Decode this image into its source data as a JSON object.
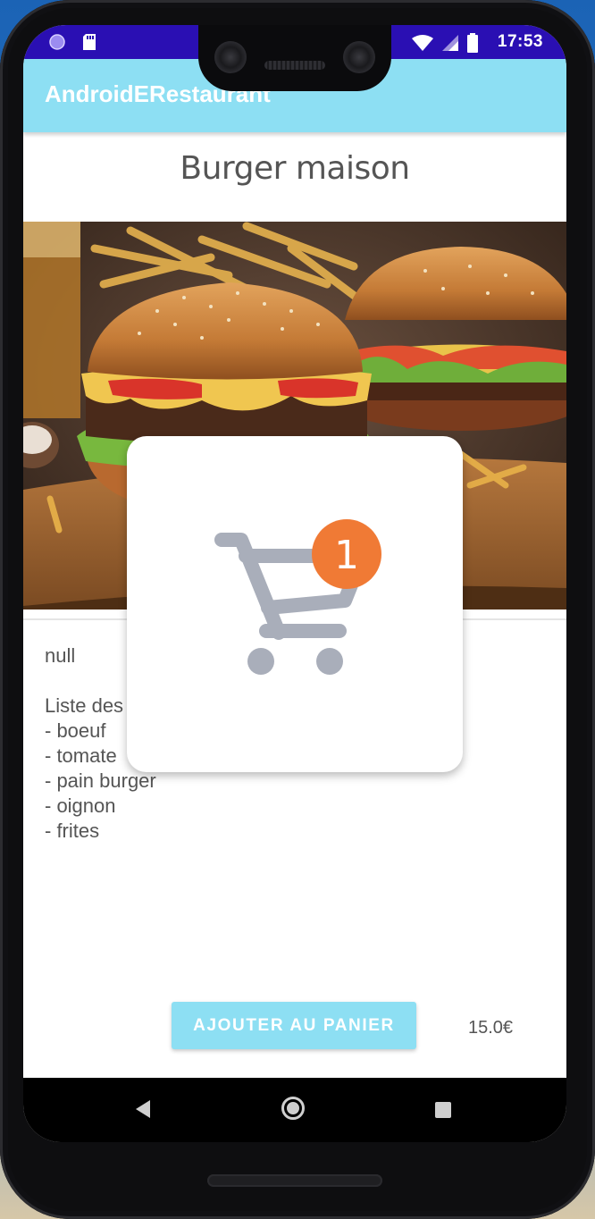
{
  "status_bar": {
    "time": "17:53",
    "left_icons": [
      "circle-notification-icon",
      "sd-card-icon"
    ],
    "right_icons": [
      "wifi-icon",
      "signal-icon",
      "battery-icon"
    ]
  },
  "app_bar": {
    "title": "AndroidERestaurant"
  },
  "dish": {
    "title": "Burger maison",
    "image_icon": "burger-photo",
    "description": "null\n\nListe des ingrédients:\n- boeuf\n- tomate\n- pain burger\n- oignon\n- frites",
    "add_to_cart_label": "AJOUTER AU PANIER",
    "price": "15.0€"
  },
  "cart_dialog": {
    "icon": "shopping-cart-icon",
    "badge_count": "1",
    "badge_color": "#f07a35",
    "cart_color": "#a9aeba"
  },
  "nav_bar": {
    "buttons": [
      "back-icon",
      "home-icon",
      "recents-icon"
    ]
  },
  "colors": {
    "accent": "#8ddff3",
    "status_bar": "#2a0fb3"
  }
}
